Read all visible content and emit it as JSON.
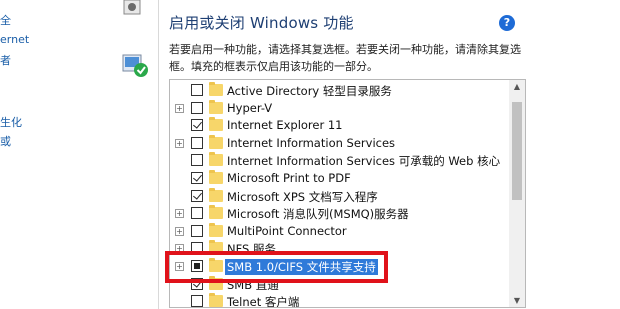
{
  "background": {
    "links": [
      "全",
      "ernet",
      "者",
      "生化",
      "或"
    ]
  },
  "dialog": {
    "title": "启用或关闭 Windows 功能",
    "help_label": "?",
    "description": "若要启用一种功能，请选择其复选框。若要关闭一种功能，请清除其复选框。填充的框表示仅启用该功能的一部分。"
  },
  "features": [
    {
      "label": "Active Directory 轻型目录服务",
      "expandable": false,
      "state": "unchecked"
    },
    {
      "label": "Hyper-V",
      "expandable": true,
      "state": "unchecked"
    },
    {
      "label": "Internet Explorer 11",
      "expandable": false,
      "state": "checked"
    },
    {
      "label": "Internet Information Services",
      "expandable": true,
      "state": "unchecked"
    },
    {
      "label": "Internet Information Services 可承载的 Web 核心",
      "expandable": false,
      "state": "unchecked"
    },
    {
      "label": "Microsoft Print to PDF",
      "expandable": false,
      "state": "checked"
    },
    {
      "label": "Microsoft XPS 文档写入程序",
      "expandable": false,
      "state": "checked"
    },
    {
      "label": "Microsoft 消息队列(MSMQ)服务器",
      "expandable": true,
      "state": "unchecked"
    },
    {
      "label": "MultiPoint Connector",
      "expandable": true,
      "state": "unchecked"
    },
    {
      "label": "NFS 服务",
      "expandable": true,
      "state": "unchecked"
    },
    {
      "label": "SMB 1.0/CIFS 文件共享支持",
      "expandable": true,
      "state": "partial",
      "selected": true
    },
    {
      "label": "SMB 直通",
      "expandable": false,
      "state": "checked"
    },
    {
      "label": "Telnet 客户端",
      "expandable": false,
      "state": "unchecked"
    }
  ],
  "icons": {
    "scroll_up": "▲",
    "scroll_down": "▼",
    "expand": "+"
  },
  "colors": {
    "selection": "#2f7ad9",
    "highlight_box": "#e0121a",
    "title": "#1e3f73"
  }
}
